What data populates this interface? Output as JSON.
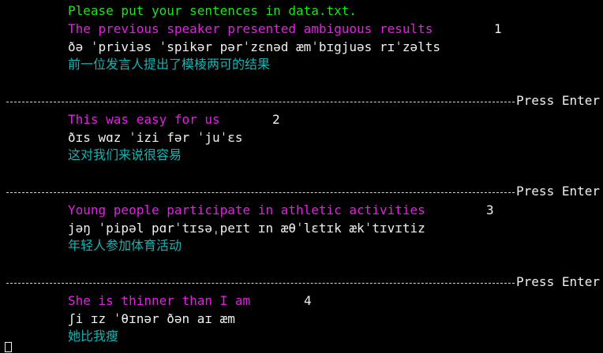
{
  "terminal": {
    "intro": "Please put your sentences in data.txt.",
    "press_enter": "Press Enter",
    "entries": [
      {
        "english": "The previous speaker presented ambiguous results",
        "number": "1",
        "ipa": "ðə ˈpriviəs ˈspikər pərˈzɛnəd æmˈbɪgjuəs rɪˈzəlts",
        "chinese": "前一位发言人提出了模棱两可的结果"
      },
      {
        "english": "This was easy for us",
        "number": "2",
        "ipa": "ðɪs wɑz ˈizi fər ˈjuˈɛs",
        "chinese": "这对我们来说很容易"
      },
      {
        "english": "Young people participate in athletic activities",
        "number": "3",
        "ipa": "jəŋ ˈpipəl pɑrˈtɪsəˌpeɪt ɪn æθˈlɛtɪk ækˈtɪvɪtiz",
        "chinese": "年轻人参加体育活动"
      },
      {
        "english": "She is thinner than I am",
        "number": "4",
        "ipa": "ʃi ɪz ˈθɪnər ðən aɪ æm",
        "chinese": "她比我瘦"
      }
    ]
  },
  "colors": {
    "background": "#000000",
    "intro": "#17e817",
    "english": "#e61ee6",
    "ipa": "#f0f0f0",
    "chinese": "#14b4b4"
  }
}
